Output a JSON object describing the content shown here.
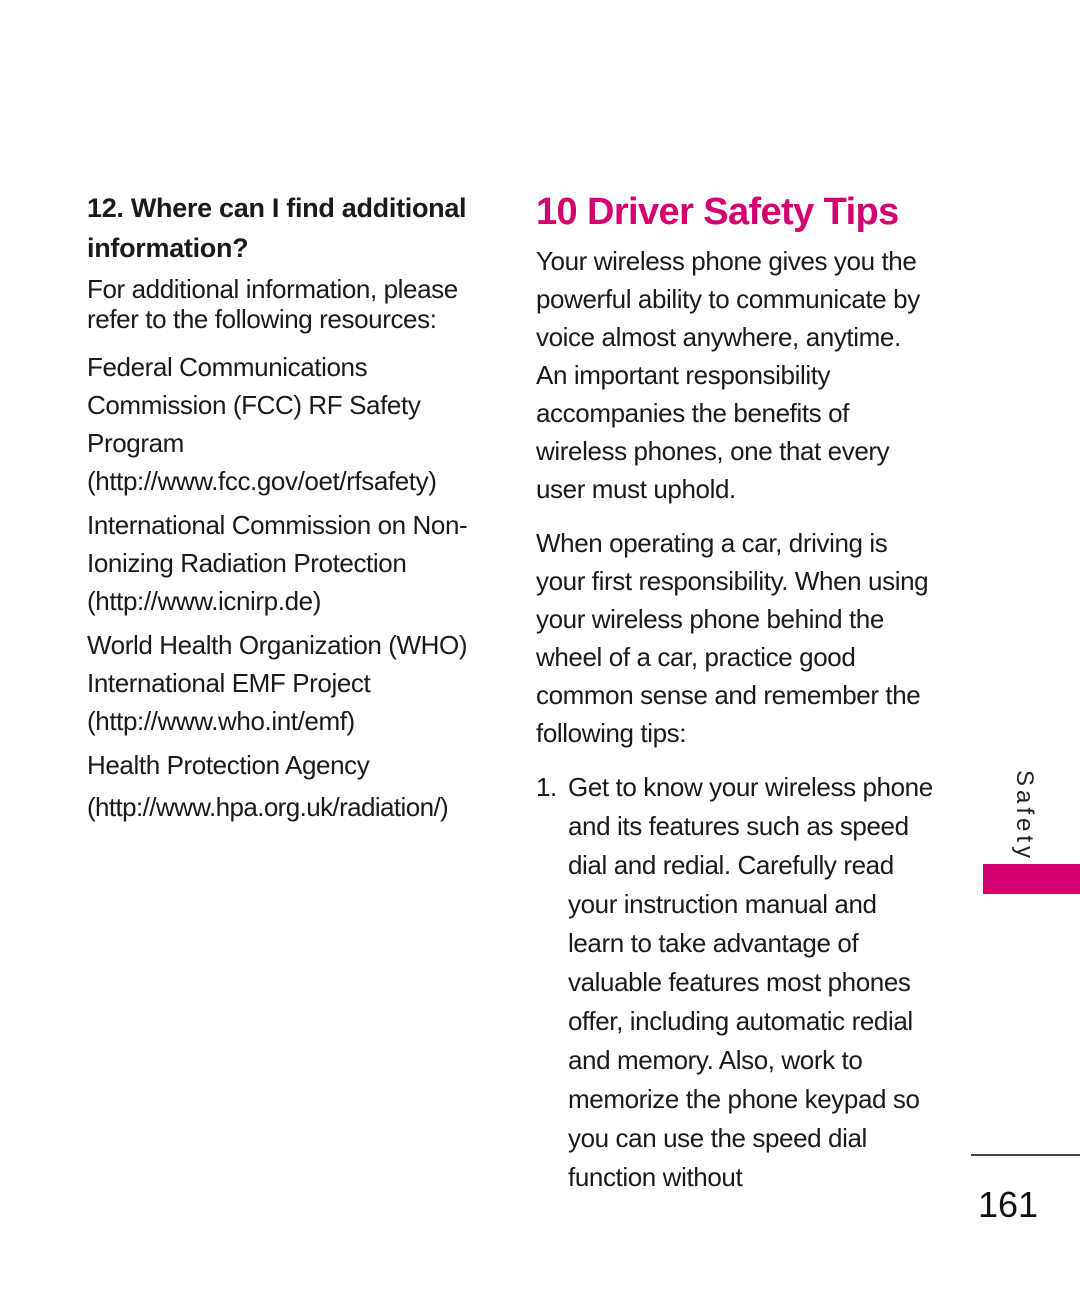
{
  "left_column": {
    "heading": "12. Where can I find additional information?",
    "intro": "For additional information, please refer to the following resources:",
    "resources": [
      {
        "name": "Federal Communications Commission (FCC) RF Safety Program",
        "url": "(http://www.fcc.gov/oet/rfsafety)"
      },
      {
        "name": "International Commission on Non-Ionizing Radiation Protection",
        "url": "(http://www.icnirp.de)"
      },
      {
        "name": "World Health Organization (WHO) International EMF Project",
        "url": "(http://www.who.int/emf)"
      },
      {
        "name": "Health Protection Agency",
        "url": "(http://www.hpa.org.uk/radiation/)"
      }
    ]
  },
  "right_column": {
    "title": "10 Driver Safety Tips",
    "paragraphs": [
      "Your wireless phone gives you the powerful ability to communicate by voice almost anywhere, anytime. An important responsibility accompanies the benefits of wireless phones, one that every user must uphold.",
      "When operating a car, driving is your first responsibility. When using your wireless phone behind the wheel of a car, practice good common sense and remember the following tips:"
    ],
    "tips": [
      {
        "num": "1.",
        "text": "Get to know your wireless phone and its features such as speed dial and redial. Carefully read your instruction manual and learn to take advantage of valuable features most phones offer, including automatic redial and memory. Also, work to memorize the phone keypad so you can use the speed dial function without"
      }
    ]
  },
  "side_tab": {
    "label": "Safety",
    "color": "#d4006f"
  },
  "page_number": "161"
}
